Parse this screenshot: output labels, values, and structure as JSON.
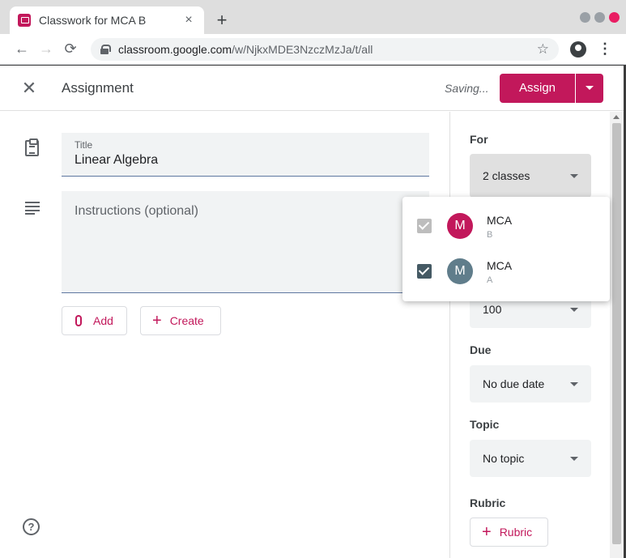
{
  "browser": {
    "tab_title": "Classwork for MCA B",
    "tab_close": "×",
    "new_tab": "+",
    "url_host": "classroom.google.com",
    "url_path": "/w/NjkxMDE3NzczMzJa/t/all",
    "nav_back": "←",
    "nav_forward": "→",
    "nav_reload": "⟳",
    "star": "☆",
    "menu": "⋮"
  },
  "header": {
    "close": "✕",
    "title": "Assignment",
    "status": "Saving...",
    "assign_label": "Assign"
  },
  "form": {
    "title_label": "Title",
    "title_value": "Linear Algebra",
    "instructions_placeholder": "Instructions (optional)",
    "add_label": "Add",
    "create_label": "Create",
    "plus": "+",
    "help": "?"
  },
  "sidebar": {
    "for_label": "For",
    "for_value": "2 classes",
    "points_value": "100",
    "due_label": "Due",
    "due_value": "No due date",
    "topic_label": "Topic",
    "topic_value": "No topic",
    "rubric_label": "Rubric"
  },
  "class_dropdown": {
    "items": [
      {
        "initial": "M",
        "name": "MCA",
        "section": "B",
        "checked": true,
        "disabled": true,
        "color": "#c2185b"
      },
      {
        "initial": "M",
        "name": "MCA",
        "section": "A",
        "checked": true,
        "disabled": false,
        "color": "#607d8b"
      }
    ]
  },
  "colors": {
    "accent": "#c2185b",
    "checkbox_checked": "#455a64",
    "checkbox_disabled": "#bdbdbd"
  }
}
